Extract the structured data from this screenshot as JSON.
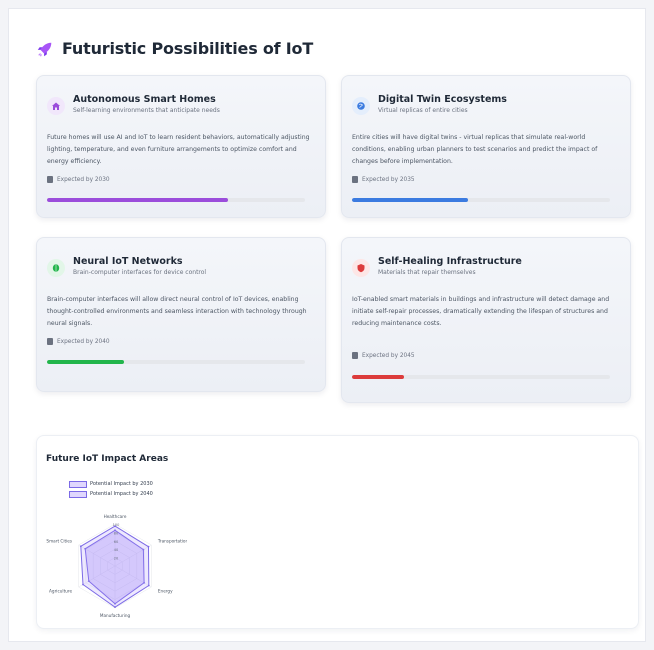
{
  "page": {
    "title": "Futuristic Possibilities of IoT",
    "icon": "rocket-icon"
  },
  "cards": [
    {
      "title": "Autonomous Smart Homes",
      "subtitle": "Self-learning environments that anticipate needs",
      "description": "Future homes will use AI and IoT to learn resident behaviors, automatically adjusting lighting, temperature, and even furniture arrangements to optimize comfort and energy efficiency.",
      "expected": "Expected by 2030",
      "icon": "home-icon",
      "accent": "#9b4ddb",
      "icon_bg": "#f1e7fb",
      "progress": 0.7
    },
    {
      "title": "Digital Twin Ecosystems",
      "subtitle": "Virtual replicas of entire cities",
      "description": "Entire cities will have digital twins - virtual replicas that simulate real-world conditions, enabling urban planners to test scenarios and predict the impact of changes before implementation.",
      "expected": "Expected by 2035",
      "icon": "globe-icon",
      "accent": "#3b7be0",
      "icon_bg": "#e4eefc",
      "progress": 0.45
    },
    {
      "title": "Neural IoT Networks",
      "subtitle": "Brain-computer interfaces for device control",
      "description": "Brain-computer interfaces will allow direct neural control of IoT devices, enabling thought-controlled environments and seamless interaction with technology through neural signals.",
      "expected": "Expected by 2040",
      "icon": "brain-icon",
      "accent": "#22b54b",
      "icon_bg": "#e2f6e8",
      "progress": 0.3
    },
    {
      "title": "Self-Healing Infrastructure",
      "subtitle": "Materials that repair themselves",
      "description": "IoT-enabled smart materials in buildings and infrastructure will detect damage and initiate self-repair processes, dramatically extending the lifespan of structures and reducing maintenance costs.",
      "expected": "Expected by 2045",
      "icon": "shield-icon",
      "accent": "#dc3b3b",
      "icon_bg": "#fde6e6",
      "progress": 0.2
    }
  ],
  "chart": {
    "title": "Future IoT Impact Areas",
    "legend": [
      "Potential Impact by 2030",
      "Potential Impact by 2040"
    ]
  },
  "chart_data": {
    "type": "radar",
    "categories": [
      "Healthcare",
      "Transportation",
      "Energy",
      "Manufacturing",
      "Agriculture",
      "Smart Cities"
    ],
    "series": [
      {
        "name": "Potential Impact by 2030",
        "values": [
          85,
          78,
          80,
          90,
          72,
          82
        ]
      },
      {
        "name": "Potential Impact by 2040",
        "values": [
          95,
          92,
          93,
          98,
          88,
          94
        ]
      }
    ],
    "r_range": [
      0,
      100
    ],
    "tick_labels": [
      "100",
      "80",
      "60",
      "40",
      "20"
    ],
    "legend_position": "top-left",
    "colors": {
      "stroke": "#7c6ae6",
      "fill": "#a78bfa"
    }
  }
}
